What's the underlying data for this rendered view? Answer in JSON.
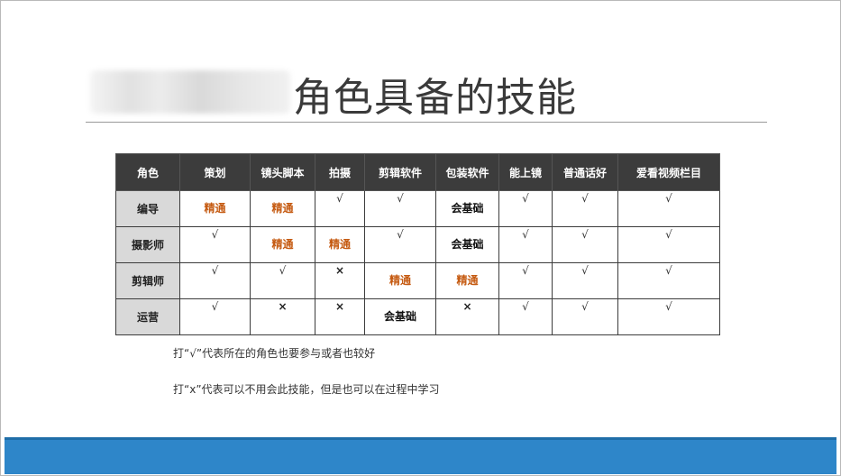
{
  "slide": {
    "title": "角色具备的技能",
    "table": {
      "headers": [
        "角色",
        "策划",
        "镜头脚本",
        "拍摄",
        "剪辑软件",
        "包装软件",
        "能上镜",
        "普通话好",
        "爱看视频栏目"
      ],
      "rows": [
        {
          "role": "编导",
          "cells": [
            {
              "type": "expert",
              "text": "精通"
            },
            {
              "type": "expert",
              "text": "精通"
            },
            {
              "type": "check",
              "text": "√"
            },
            {
              "type": "check",
              "text": "√"
            },
            {
              "type": "basic",
              "text": "会基础"
            },
            {
              "type": "check",
              "text": "√"
            },
            {
              "type": "check",
              "text": "√"
            },
            {
              "type": "check",
              "text": "√"
            }
          ]
        },
        {
          "role": "摄影师",
          "cells": [
            {
              "type": "check",
              "text": "√"
            },
            {
              "type": "expert",
              "text": "精通"
            },
            {
              "type": "expert",
              "text": "精通"
            },
            {
              "type": "check",
              "text": "√"
            },
            {
              "type": "basic",
              "text": "会基础"
            },
            {
              "type": "check",
              "text": "√"
            },
            {
              "type": "check",
              "text": "√"
            },
            {
              "type": "check",
              "text": "√"
            }
          ]
        },
        {
          "role": "剪辑师",
          "cells": [
            {
              "type": "check",
              "text": "√"
            },
            {
              "type": "check",
              "text": "√"
            },
            {
              "type": "cross",
              "text": "×"
            },
            {
              "type": "expert",
              "text": "精通"
            },
            {
              "type": "expert",
              "text": "精通"
            },
            {
              "type": "check",
              "text": "√"
            },
            {
              "type": "check",
              "text": "√"
            },
            {
              "type": "check",
              "text": "√"
            }
          ]
        },
        {
          "role": "运营",
          "cells": [
            {
              "type": "check",
              "text": "√"
            },
            {
              "type": "cross",
              "text": "×"
            },
            {
              "type": "cross",
              "text": "×"
            },
            {
              "type": "basic",
              "text": "会基础"
            },
            {
              "type": "cross",
              "text": "×"
            },
            {
              "type": "check",
              "text": "√"
            },
            {
              "type": "check",
              "text": "√"
            },
            {
              "type": "check",
              "text": "√"
            }
          ]
        }
      ]
    },
    "notes": [
      "打“√”代表所在的角色也要参与或者也较好",
      "打“x”代表可以不用会此技能，但是也可以在过程中学习"
    ],
    "colors": {
      "expert": "#c55a11",
      "header_bg": "#3c3c3c",
      "role_bg": "#d9d9d9",
      "footer_bar": "#2e86c9"
    }
  }
}
